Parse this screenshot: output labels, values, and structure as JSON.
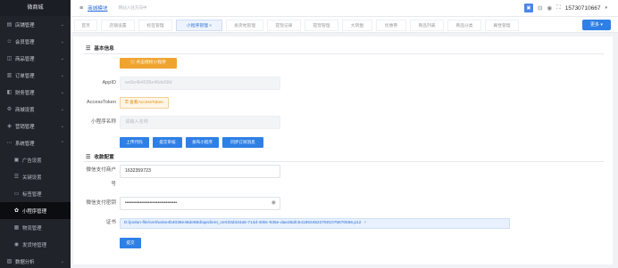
{
  "sidebar": {
    "brand": "微商城",
    "items": [
      {
        "label": "店铺管理",
        "icon": "shop-icon"
      },
      {
        "label": "会员管理",
        "icon": "user-icon"
      },
      {
        "label": "商品管理",
        "icon": "bag-icon"
      },
      {
        "label": "订单管理",
        "icon": "order-icon"
      },
      {
        "label": "财务管理",
        "icon": "wallet-icon"
      },
      {
        "label": "商城设置",
        "icon": "gear-icon"
      },
      {
        "label": "营销管理",
        "icon": "megaphone-icon"
      },
      {
        "label": "系统管理",
        "icon": "system-icon"
      }
    ],
    "sub_items": [
      {
        "label": "广告设置",
        "icon": "image-icon"
      },
      {
        "label": "关键设置",
        "icon": "list-icon"
      },
      {
        "label": "标签管理",
        "icon": "tag-icon"
      },
      {
        "label": "小程序管理",
        "icon": "miniprogram-icon"
      },
      {
        "label": "物流管理",
        "icon": "truck-icon"
      },
      {
        "label": "发货地管理",
        "icon": "location-icon"
      }
    ],
    "bottom_item": {
      "label": "数据分析",
      "icon": "chart-icon"
    }
  },
  "topbar": {
    "shop_name": "商城模块",
    "shop_sub": "网站入驻方向中",
    "phone": "15730710667"
  },
  "tabs": [
    "首页",
    "店铺设置",
    "标签管理",
    "小程序管理",
    "发货地管理",
    "提现记录",
    "提现管理",
    "大转盘",
    "优惠券",
    "商品列表",
    "商品分类",
    "属性管理"
  ],
  "more_label": "更多",
  "basic": {
    "title": "基本信息",
    "bind_btn": "点击授权小程序",
    "appid_label": "AppID",
    "appid_value": "wx5e4b4036e46de68d",
    "token_label": "AccessToken",
    "token_value": "查看AccessToken",
    "name_label": "小程序名称",
    "name_value": "请输入名称",
    "actions": [
      "上传代码",
      "提交审核",
      "发布小程序",
      "同步订阅消息"
    ]
  },
  "pay": {
    "title": "收款配置",
    "merchant_label_1": "微信支付商户",
    "merchant_label_2": "号",
    "merchant_value": "1632359723",
    "secret_label": "微信支付密钥",
    "secret_value": "••••••••••••••••••••••••••••••••",
    "cert_label": "证书",
    "cert_value": "D:/joolun-file/cert/wx5e4b4036e46de68d/apiclient_cert33d434a5-714d-408c-935e-dae26afc54186345227501075870556.p12",
    "submit": "提交"
  }
}
